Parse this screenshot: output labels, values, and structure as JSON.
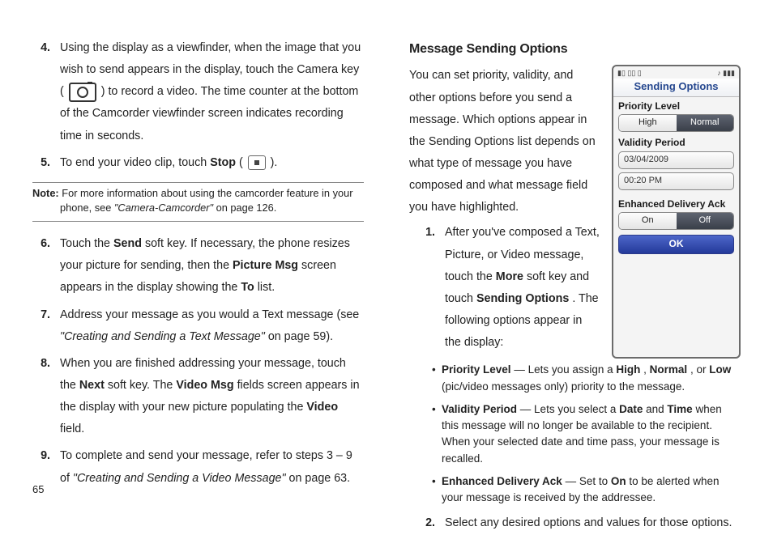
{
  "page_number": "65",
  "left": {
    "items": {
      "4": {
        "num": "4.",
        "text_plain": "Using the display as a viewfinder, when the image that you wish to send appears in the display, touch the Camera key ( ",
        "text_after_icon": " ) to record a video. The time counter at the bottom of the Camcorder viewfinder screen indicates recording time in seconds."
      },
      "5": {
        "num": "5.",
        "pre": "To end your video clip, touch ",
        "bold1": "Stop",
        "mid": " ( ",
        "post": " )."
      },
      "6": {
        "num": "6.",
        "a": "Touch the ",
        "b": "Send",
        "c": " soft key. If necessary, the phone resizes your picture for sending, then the ",
        "d": "Picture Msg",
        "e": " screen appears in the display showing the ",
        "f": "To",
        "g": " list."
      },
      "7": {
        "num": "7.",
        "a": "Address your message as you would a Text message (see ",
        "ref": "\"Creating and Sending a Text Message\"",
        "b": " on page 59)."
      },
      "8": {
        "num": "8.",
        "a": "When you are finished addressing your message, touch the ",
        "b": "Next",
        "c": " soft key. The ",
        "d": "Video Msg",
        "e": " fields screen appears in the display with your new picture populating the ",
        "f": "Video",
        "g": " field."
      },
      "9": {
        "num": "9.",
        "a": "To complete and send your message, refer to steps 3 – 9 of ",
        "ref": "\"Creating and Sending a Video Message\"",
        "b": " on page 63."
      }
    },
    "note": {
      "lead": "Note:",
      "a": " For more information about using the camcorder feature in your ",
      "b": "phone, see ",
      "ref": "\"Camera-Camcorder\"",
      "c": " on page 126."
    }
  },
  "right": {
    "heading": "Message Sending Options",
    "intro": "You can set priority, validity, and other options before you send a message. Which options appear in the Sending Options list depends on what type of message you have composed and what message field you have highlighted.",
    "items": {
      "1": {
        "num": "1.",
        "a": "After you've composed a Text, Picture, or Video message, touch the ",
        "b": "More",
        "c": " soft key and touch ",
        "d": "Sending Options",
        "e": ". The following options appear in the display:"
      },
      "2": {
        "num": "2.",
        "text": "Select any desired options and values for those options."
      }
    },
    "bullets": {
      "priority": {
        "lead": "Priority Level",
        "a": " — Lets you assign a ",
        "h": "High",
        "b": ", ",
        "n": "Normal",
        "c": ", or ",
        "l": "Low",
        "d": " (pic/video messages only) priority to the message."
      },
      "validity": {
        "lead": "Validity Period",
        "a": " — Lets you select a ",
        "date": "Date",
        "b": " and ",
        "time": "Time",
        "c": " when this message will no longer be available to the recipient. When your selected date and time pass, your message is recalled."
      },
      "ack": {
        "lead": "Enhanced Delivery Ack",
        "a": " — Set to ",
        "on": "On",
        "b": " to be alerted when your message is received by the addressee."
      }
    },
    "phone": {
      "title": "Sending Options",
      "status_left": "▮▯  ▯▯ ▯",
      "status_right": "♪ ▮▮▮",
      "priority_label": "Priority Level",
      "priority_high": "High",
      "priority_normal": "Normal",
      "validity_label": "Validity Period",
      "date": "03/04/2009",
      "time": "00:20 PM",
      "ack_label": "Enhanced Delivery Ack",
      "ack_on": "On",
      "ack_off": "Off",
      "ok": "OK"
    }
  }
}
